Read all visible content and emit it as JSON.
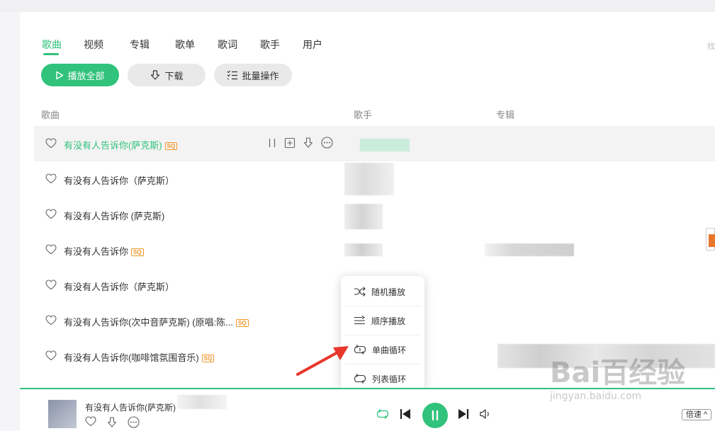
{
  "tabs": [
    {
      "label": "歌曲",
      "active": true
    },
    {
      "label": "视频"
    },
    {
      "label": "专辑"
    },
    {
      "label": "歌单"
    },
    {
      "label": "歌词"
    },
    {
      "label": "歌手"
    },
    {
      "label": "用户"
    }
  ],
  "corner_text": "找",
  "actions": {
    "play_all": "播放全部",
    "download": "下载",
    "batch": "批量操作"
  },
  "columns": {
    "song": "歌曲",
    "singer": "歌手",
    "album": "专辑"
  },
  "songs": [
    {
      "title": "有没有人告诉你(萨克斯)",
      "badge": "SQ"
    },
    {
      "title": "有没有人告诉你（萨克斯）",
      "badge": ""
    },
    {
      "title": "有没有人告诉你 (萨克斯)",
      "badge": ""
    },
    {
      "title": "有没有人告诉你",
      "badge": "SQ"
    },
    {
      "title": "有没有人告诉你（萨克斯）",
      "badge": ""
    },
    {
      "title": "有没有人告诉你(次中音萨克斯) (原唱:陈...",
      "badge": "SQ"
    },
    {
      "title": "有没有人告诉你(咖啡馆氛围音乐)",
      "badge": "SQ"
    }
  ],
  "play_mode_menu": [
    {
      "label": "随机播放",
      "icon": "shuffle-icon"
    },
    {
      "label": "顺序播放",
      "icon": "sequence-icon"
    },
    {
      "label": "单曲循环",
      "icon": "repeat-one-icon"
    },
    {
      "label": "列表循环",
      "icon": "repeat-list-icon"
    }
  ],
  "player": {
    "now_playing": "有没有人告诉你(萨克斯)",
    "speed": "倍速"
  },
  "watermark": {
    "main": "Bai百经验",
    "sub": "jingyan.baidu.com"
  },
  "colors": {
    "accent": "#31c27c",
    "badge": "#f09628",
    "arrow": "#e8362b"
  }
}
